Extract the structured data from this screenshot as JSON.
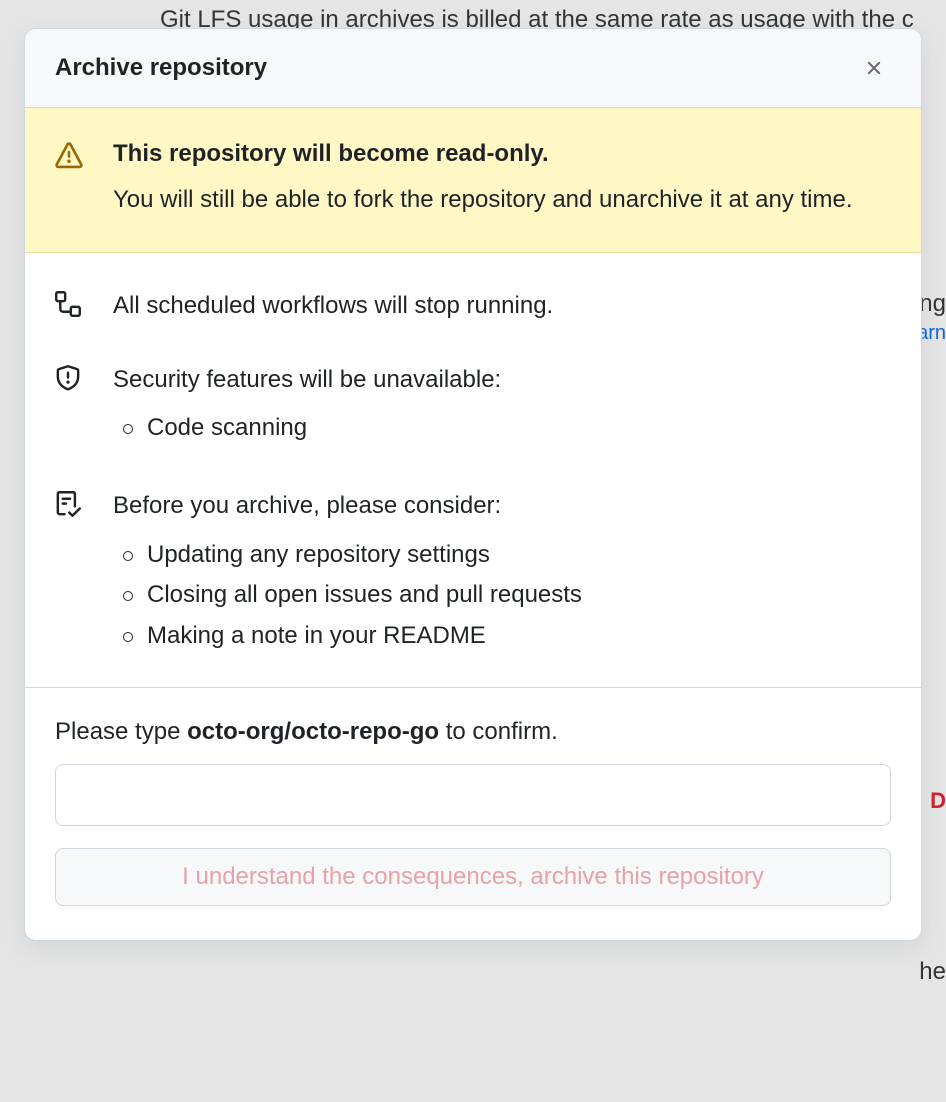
{
  "background": {
    "top_text": "Git LFS usage in archives is billed at the same rate as usage with the c",
    "right_text_1": "ng",
    "right_text_2": "arn",
    "right_text_3": "D",
    "right_text_4": "he"
  },
  "dialog": {
    "title": "Archive repository",
    "warning": {
      "title": "This repository will become read-only.",
      "description": "You will still be able to fork the repository and unarchive it at any time."
    },
    "workflows": {
      "text": "All scheduled workflows will stop running."
    },
    "security": {
      "title": "Security features will be unavailable:",
      "items": [
        "Code scanning"
      ]
    },
    "consider": {
      "title": "Before you archive, please consider:",
      "items": [
        "Updating any repository settings",
        "Closing all open issues and pull requests",
        "Making a note in your README"
      ]
    },
    "confirm": {
      "prefix": "Please type ",
      "repo_name": "octo-org/octo-repo-go",
      "suffix": " to confirm.",
      "input_value": "",
      "button_label": "I understand the consequences, archive this repository"
    }
  }
}
